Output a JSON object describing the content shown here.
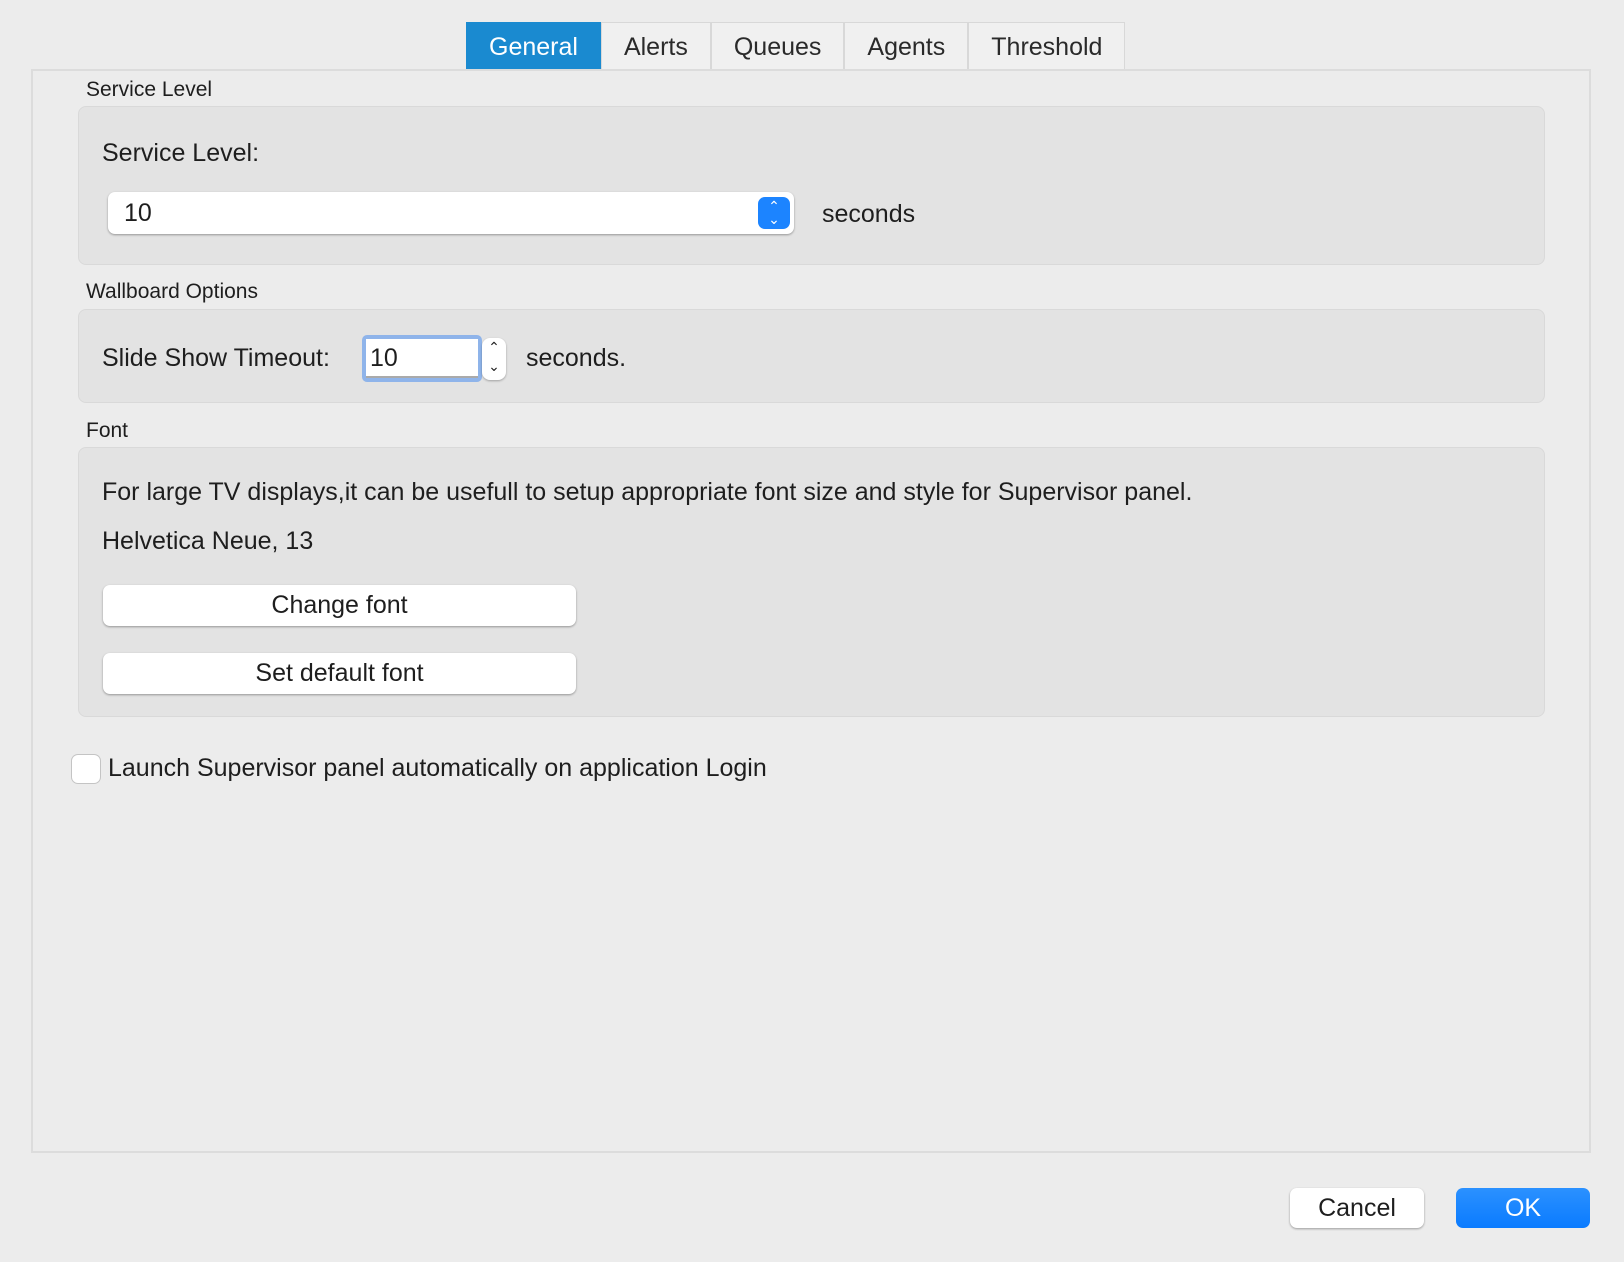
{
  "tabs": [
    {
      "label": "General",
      "active": true
    },
    {
      "label": "Alerts"
    },
    {
      "label": "Queues"
    },
    {
      "label": "Agents"
    },
    {
      "label": "Threshold"
    }
  ],
  "service_level": {
    "group_title": "Service Level",
    "label": "Service Level:",
    "value": "10",
    "unit": "seconds"
  },
  "wallboard": {
    "group_title": "Wallboard Options",
    "label": "Slide Show Timeout:",
    "value": "10",
    "unit": "seconds."
  },
  "font": {
    "group_title": "Font",
    "description": "For large TV displays,it can be usefull to setup appropriate font size and style for Supervisor panel.",
    "current_font": "Helvetica Neue, 13",
    "change_label": "Change font",
    "default_label": "Set default font"
  },
  "launch_checkbox": {
    "label": "Launch Supervisor panel automatically on application Login",
    "checked": false
  },
  "footer": {
    "cancel_label": "Cancel",
    "ok_label": "OK"
  },
  "colors": {
    "accent": "#1a8ad0",
    "ok_button": "#0a7bff"
  }
}
